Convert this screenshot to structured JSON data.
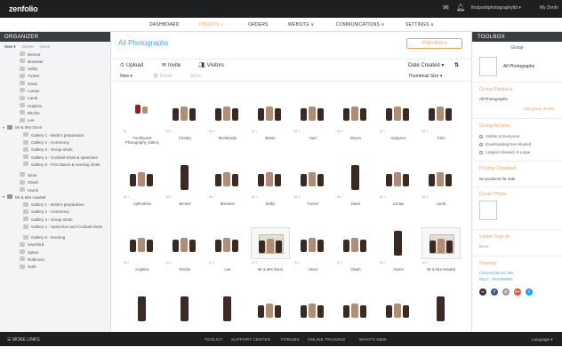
{
  "topbar": {
    "logo": "zenfolio",
    "account": "firstpointphotographyltd ▾",
    "account2": "My Zenfo"
  },
  "nav": {
    "items": [
      {
        "label": "DASHBOARD",
        "active": false
      },
      {
        "label": "PHOTOS ∨",
        "active": true
      },
      {
        "label": "ORDERS",
        "active": false
      },
      {
        "label": "WEBSITE ∨",
        "active": false
      },
      {
        "label": "COMMUNICATIONS ∨",
        "active": false
      },
      {
        "label": "SETTINGS ∨",
        "active": false
      }
    ]
  },
  "organizer": {
    "title": "ORGANIZER",
    "tabs": [
      "New ▾",
      "Delete",
      "Move"
    ],
    "items": [
      {
        "label": "Bennet",
        "indent": 1,
        "multi": false
      },
      {
        "label": "Brewster",
        "indent": 1,
        "multi": false
      },
      {
        "label": "Selby",
        "indent": 1,
        "multi": false
      },
      {
        "label": "Tucker",
        "indent": 1,
        "multi": false
      },
      {
        "label": "Davis",
        "indent": 1,
        "multi": false
      },
      {
        "label": "Lomax",
        "indent": 1,
        "multi": false
      },
      {
        "label": "Lamb",
        "indent": 1,
        "multi": false
      },
      {
        "label": "Hopkins",
        "indent": 1,
        "multi": false
      },
      {
        "label": "Ritchie",
        "indent": 1,
        "multi": false
      },
      {
        "label": "Lee",
        "indent": 1,
        "multi": false
      },
      {
        "label": "Mr & Mrs Dunn",
        "indent": 0,
        "multi": false
      },
      {
        "label": "Gallery 1 - Bride's preparation",
        "indent": 2,
        "multi": false
      },
      {
        "label": "Gallery 2 - Ceremony",
        "indent": 2,
        "multi": false
      },
      {
        "label": "Gallery 3 - Group shots",
        "indent": 2,
        "multi": false
      },
      {
        "label": "Gallery 4 - Cocktail shots & speeches",
        "indent": 2,
        "multi": false
      },
      {
        "label": "Gallery 5 - First dance & evening shots",
        "indent": 2,
        "multi": true
      },
      {
        "label": "Stout",
        "indent": 1,
        "multi": false
      },
      {
        "label": "Oleah",
        "indent": 1,
        "multi": false
      },
      {
        "label": "Harris",
        "indent": 1,
        "multi": false
      },
      {
        "label": "Mr & Mrs Howlett",
        "indent": 0,
        "multi": false
      },
      {
        "label": "Gallery 1 - Bride's preparation",
        "indent": 2,
        "multi": false
      },
      {
        "label": "Gallery 2 - Ceremony",
        "indent": 2,
        "multi": false
      },
      {
        "label": "Gallery 3 - Group shots",
        "indent": 2,
        "multi": false
      },
      {
        "label": "Gallery 4 - Speeches and Cocktail shots",
        "indent": 2,
        "multi": true
      },
      {
        "label": "Gallery 5 - Evening",
        "indent": 2,
        "multi": false
      },
      {
        "label": "Hansford",
        "indent": 1,
        "multi": false
      },
      {
        "label": "Sykes",
        "indent": 1,
        "multi": false
      },
      {
        "label": "Robinson",
        "indent": 1,
        "multi": false
      },
      {
        "label": "Goth",
        "indent": 1,
        "multi": false
      }
    ]
  },
  "main": {
    "title": "All Photographs",
    "preview": "PREVIEW ▾",
    "toolbar": {
      "upload": "Upload",
      "invite": "Invite",
      "visitors": "Visitors",
      "sort": "Date Created ▾",
      "new": "New ▾",
      "delete": "Delete",
      "move": "Move",
      "thumb_size": "Thumbnail Size ▾"
    },
    "rows": [
      [
        {
          "caption": "Fourthpoint Photography Gallery",
          "meta": "▤",
          "kind": "dark",
          "frame": "none"
        },
        {
          "caption": "Chatley",
          "meta": "▤ 5",
          "kind": "group",
          "frame": "none"
        },
        {
          "caption": "Montelaide",
          "meta": "▤ 5",
          "kind": "group",
          "frame": "none"
        },
        {
          "caption": "Baker",
          "meta": "▤ 5",
          "kind": "group",
          "frame": "none"
        },
        {
          "caption": "Hart",
          "meta": "▤ 5",
          "kind": "group",
          "frame": "none"
        },
        {
          "caption": "Brown",
          "meta": "▤ 5",
          "kind": "group",
          "frame": "none"
        },
        {
          "caption": "Hargrove",
          "meta": "▤ 5",
          "kind": "group",
          "frame": "none"
        },
        {
          "caption": "Tuke",
          "meta": "▤ 5",
          "kind": "group",
          "frame": "none"
        }
      ],
      [
        {
          "caption": "Aphrodrive",
          "meta": "▤ 5",
          "kind": "group",
          "frame": "none"
        },
        {
          "caption": "Bennet",
          "meta": "▤ 5",
          "kind": "tall",
          "frame": "none"
        },
        {
          "caption": "Brewster",
          "meta": "▤ 5",
          "kind": "group",
          "frame": "none"
        },
        {
          "caption": "Selby",
          "meta": "▤ 5",
          "kind": "group",
          "frame": "none"
        },
        {
          "caption": "Tucker",
          "meta": "▤ 5",
          "kind": "group",
          "frame": "none"
        },
        {
          "caption": "Davis",
          "meta": "▤ 5",
          "kind": "tall",
          "frame": "none"
        },
        {
          "caption": "Lomax",
          "meta": "▤ 5",
          "kind": "group",
          "frame": "none"
        },
        {
          "caption": "Lamb",
          "meta": "▤ 5",
          "kind": "group",
          "frame": "none"
        }
      ],
      [
        {
          "caption": "Hopkins",
          "meta": "▤ 5",
          "kind": "group",
          "frame": "none"
        },
        {
          "caption": "Ritchie",
          "meta": "▤ 5",
          "kind": "group",
          "frame": "none"
        },
        {
          "caption": "Lee",
          "meta": "▤ 5",
          "kind": "group",
          "frame": "none"
        },
        {
          "caption": "Mr & Mrs Dunn",
          "meta": "▤ 5",
          "kind": "group",
          "frame": "framed"
        },
        {
          "caption": "Stout",
          "meta": "▤ 5",
          "kind": "group",
          "frame": "none"
        },
        {
          "caption": "Oleah",
          "meta": "▤ 5",
          "kind": "group",
          "frame": "none"
        },
        {
          "caption": "Harris",
          "meta": "▤ 5",
          "kind": "tall",
          "frame": "none"
        },
        {
          "caption": "Mr & Mrs Howlett",
          "meta": "▤ 5",
          "kind": "group",
          "frame": "framed"
        }
      ],
      [
        {
          "caption": "",
          "meta": "",
          "kind": "tall",
          "frame": "none"
        },
        {
          "caption": "",
          "meta": "",
          "kind": "tall",
          "frame": "none"
        },
        {
          "caption": "",
          "meta": "",
          "kind": "tall",
          "frame": "none"
        },
        {
          "caption": "",
          "meta": "",
          "kind": "group",
          "frame": "none"
        },
        {
          "caption": "",
          "meta": "",
          "kind": "group",
          "frame": "none"
        },
        {
          "caption": "",
          "meta": "",
          "kind": "group",
          "frame": "none"
        },
        {
          "caption": "",
          "meta": "",
          "kind": "group",
          "frame": "none"
        },
        {
          "caption": "",
          "meta": "",
          "kind": "tall",
          "frame": "none"
        }
      ]
    ]
  },
  "toolbox": {
    "title": "TOOLBOX",
    "group_label": "Group",
    "card_label": "All Photographs",
    "group_details_title": "Group Details ▸",
    "group_details_text": "All Photographs",
    "edit_link": "Edit group details",
    "group_access_title": "Group Access",
    "access_rows": [
      "Visible to Everyone",
      "Downloading Not Allowed",
      "Largest Allowed: X-Large"
    ],
    "pricing_title": "Pricing: Disabled",
    "pricing_text": "No products for sale",
    "cover_title": "Cover Photo",
    "visitor_title": "Visitor Sign-In",
    "visitor_text": "None",
    "sharing_title": "Sharing",
    "share_line1": "Current Internet URL",
    "share_line2": "http://...P033989945",
    "social": [
      {
        "icon": "link-icon",
        "glyph": "∞",
        "color": "#333333"
      },
      {
        "icon": "facebook-icon",
        "glyph": "f",
        "color": "#3b5998"
      },
      {
        "icon": "email-icon",
        "glyph": "@",
        "color": "#999999"
      },
      {
        "icon": "google-plus-icon",
        "glyph": "G+",
        "color": "#dd4b39"
      },
      {
        "icon": "twitter-icon",
        "glyph": "t",
        "color": "#1da1f2"
      }
    ]
  },
  "footer": {
    "more_links": "☰ MORE LINKS",
    "links": [
      "TOOLKIT",
      "SUPPORT CENTER",
      "FORUMS",
      "ONLINE TRAINING",
      "WHAT'S NEW"
    ],
    "language": "Language ▾"
  },
  "colors": {
    "accent": "#f0a35c",
    "link": "#4aa3df",
    "dark_bar": "#1d1f21"
  }
}
